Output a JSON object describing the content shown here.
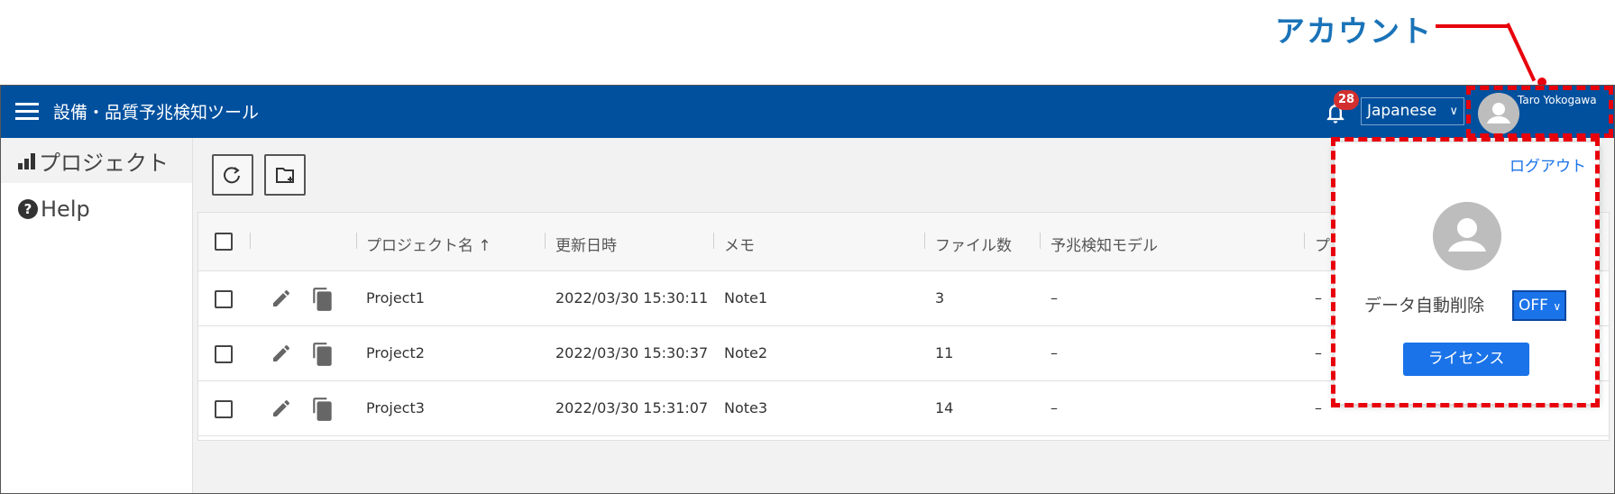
{
  "annotation": {
    "label": "アカウント",
    "color": "#e8000b"
  },
  "header": {
    "app_title": "設備・品質予兆検知ツール",
    "menu_icon": "hamburger-menu-icon",
    "notification_count": "28",
    "language": "Japanese",
    "user_name": "Taro Yokogawa",
    "bar_color": "#00509e"
  },
  "sidebar": {
    "items": [
      {
        "label": "プロジェクト",
        "icon": "bar-chart-icon"
      },
      {
        "label": "Help",
        "icon": "help-circle-icon"
      }
    ]
  },
  "toolbar": {
    "buttons": [
      {
        "icon": "refresh-icon"
      },
      {
        "icon": "new-folder-icon"
      }
    ]
  },
  "table": {
    "columns": [
      "プロジェクト名 ↑",
      "更新日時",
      "メモ",
      "ファイル数",
      "予兆検知モデル",
      "プ"
    ],
    "rows": [
      {
        "name": "Project1",
        "updated": "2022/03/30 15:30:11",
        "memo": "Note1",
        "files": "3",
        "model": "–",
        "extra": "–"
      },
      {
        "name": "Project2",
        "updated": "2022/03/30 15:30:37",
        "memo": "Note2",
        "files": "11",
        "model": "–",
        "extra": "–"
      },
      {
        "name": "Project3",
        "updated": "2022/03/30 15:31:07",
        "memo": "Note3",
        "files": "14",
        "model": "–",
        "extra": "–"
      }
    ]
  },
  "account_menu": {
    "logout": "ログアウト",
    "auto_delete_label": "データ自動削除",
    "auto_delete_value": "OFF",
    "license_button": "ライセンス",
    "accent_color": "#1a73e8"
  }
}
